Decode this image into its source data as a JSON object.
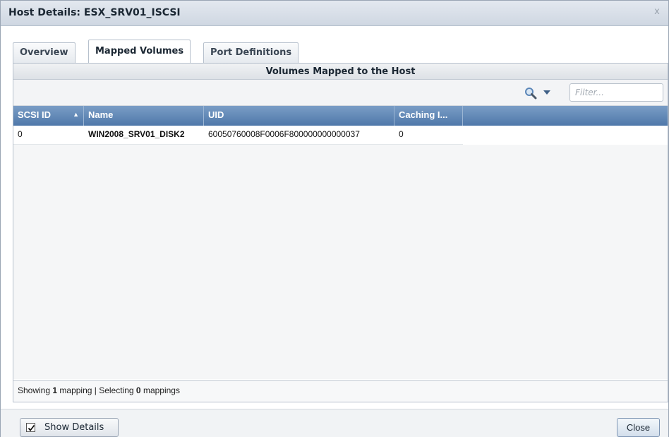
{
  "window": {
    "title": "Host Details: ESX_SRV01_ISCSI",
    "close_glyph": "x"
  },
  "tabs": [
    {
      "label": "Overview",
      "active": false
    },
    {
      "label": "Mapped Volumes",
      "active": true
    },
    {
      "label": "Port Definitions",
      "active": false
    }
  ],
  "panel": {
    "header": "Volumes Mapped to the Host",
    "toolbar": {
      "search_icon": "search-magnifier-icon",
      "dropdown_icon": "chevron-down-icon",
      "filter_placeholder": "Filter..."
    },
    "columns": [
      {
        "label": "SCSI ID",
        "sorted": "ascending",
        "sort_glyph": "▲"
      },
      {
        "label": "Name"
      },
      {
        "label": "UID"
      },
      {
        "label": "Caching I..."
      }
    ],
    "rows": [
      {
        "scsi_id": "0",
        "name": "WIN2008_SRV01_DISK2",
        "uid": "60050760008F0006F800000000000037",
        "caching": "0"
      }
    ],
    "status": {
      "prefix": "Showing ",
      "shown_count": "1",
      "middle": " mapping | Selecting ",
      "selected_count": "0",
      "suffix": " mappings"
    }
  },
  "footer": {
    "show_details_label": "Show Details",
    "show_details_checked": true,
    "close_label": "Close"
  },
  "colors": {
    "column_header_bg": "#5a80b0",
    "accent": "#4f78aa",
    "search_icon": "#5b86b8"
  }
}
